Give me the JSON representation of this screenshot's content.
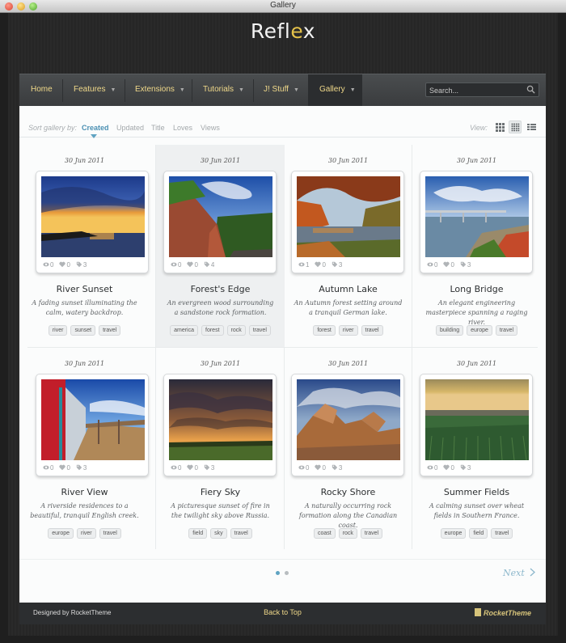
{
  "window": {
    "title": "Gallery"
  },
  "logo": {
    "text": "Refl",
    "accent": "e",
    "tail": "x"
  },
  "nav": {
    "items": [
      {
        "label": "Home",
        "chevron": false
      },
      {
        "label": "Features",
        "chevron": true
      },
      {
        "label": "Extensions",
        "chevron": true
      },
      {
        "label": "Tutorials",
        "chevron": true
      },
      {
        "label": "J! Stuff",
        "chevron": true
      },
      {
        "label": "Gallery",
        "chevron": true,
        "active": true
      }
    ],
    "search_placeholder": "Search..."
  },
  "sortbar": {
    "label": "Sort gallery by:",
    "options": [
      "Created",
      "Updated",
      "Title",
      "Loves",
      "Views"
    ],
    "active": "Created",
    "view_label": "View:"
  },
  "items": [
    {
      "date": "30 Jun 2011",
      "title": "River Sunset",
      "desc": "A fading sunset illuminating the calm, watery backdrop.",
      "views": "0",
      "loves": "0",
      "tags_count": "3",
      "tags": [
        "river",
        "sunset",
        "travel"
      ]
    },
    {
      "date": "30 Jun 2011",
      "title": "Forest's Edge",
      "desc": "An evergreen wood surrounding a sandstone rock formation.",
      "views": "0",
      "loves": "0",
      "tags_count": "4",
      "tags": [
        "america",
        "forest",
        "rock",
        "travel"
      ]
    },
    {
      "date": "30 Jun 2011",
      "title": "Autumn Lake",
      "desc": "An Autumn forest setting around a tranquil German lake.",
      "views": "1",
      "loves": "0",
      "tags_count": "3",
      "tags": [
        "forest",
        "river",
        "travel"
      ]
    },
    {
      "date": "30 Jun 2011",
      "title": "Long Bridge",
      "desc": "An elegant engineering masterpiece spanning a raging river.",
      "views": "0",
      "loves": "0",
      "tags_count": "3",
      "tags": [
        "building",
        "europe",
        "travel"
      ]
    },
    {
      "date": "30 Jun 2011",
      "title": "River View",
      "desc": "A riverside residences to a beautiful, tranquil English creek.",
      "views": "0",
      "loves": "0",
      "tags_count": "3",
      "tags": [
        "europe",
        "river",
        "travel"
      ]
    },
    {
      "date": "30 Jun 2011",
      "title": "Fiery Sky",
      "desc": "A picturesque sunset of fire in the twilight sky above Russia.",
      "views": "0",
      "loves": "0",
      "tags_count": "3",
      "tags": [
        "field",
        "sky",
        "travel"
      ]
    },
    {
      "date": "30 Jun 2011",
      "title": "Rocky Shore",
      "desc": "A naturally occurring rock formation along the Canadian coast.",
      "views": "0",
      "loves": "0",
      "tags_count": "3",
      "tags": [
        "coast",
        "rock",
        "travel"
      ]
    },
    {
      "date": "30 Jun 2011",
      "title": "Summer Fields",
      "desc": "A calming sunset over wheat fields in Southern France.",
      "views": "0",
      "loves": "0",
      "tags_count": "3",
      "tags": [
        "europe",
        "field",
        "travel"
      ]
    }
  ],
  "pager": {
    "next_label": "Next",
    "pages": 2,
    "current": 1
  },
  "footer": {
    "credit": "Designed by RocketTheme",
    "back_to_top": "Back to Top",
    "brand": "RocketTheme"
  },
  "colors": {
    "accent": "#4b90b3",
    "nav_text": "#f0d98a",
    "background": "#1f1f1f"
  }
}
